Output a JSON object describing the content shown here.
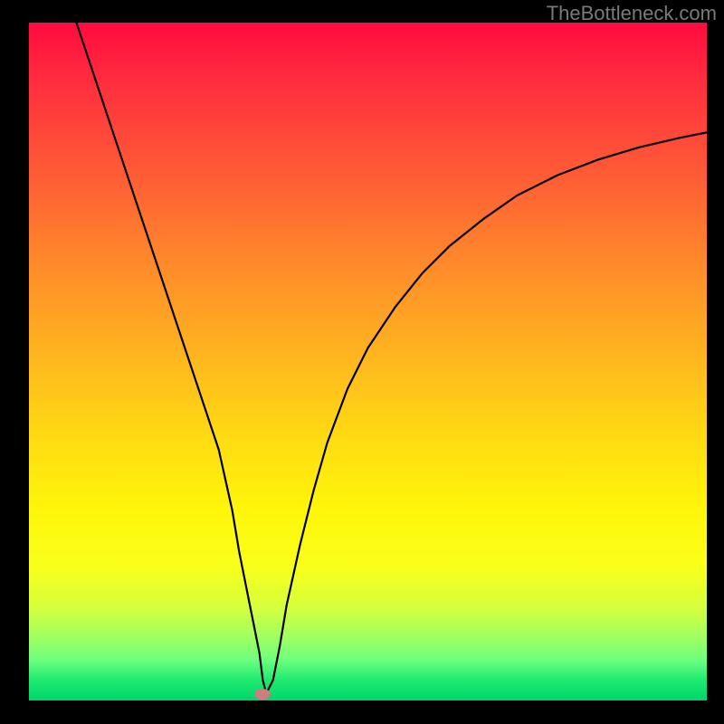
{
  "watermark": "TheBottleneck.com",
  "colors": {
    "frame": "#000000",
    "curve": "#000000",
    "marker": "#cc7d80"
  },
  "chart_data": {
    "type": "line",
    "title": "",
    "xlabel": "",
    "ylabel": "",
    "xlim": [
      0,
      100
    ],
    "ylim": [
      0,
      100
    ],
    "grid": false,
    "legend": false,
    "x": [
      7,
      10,
      13,
      16,
      19,
      22,
      25,
      28,
      30,
      31,
      32,
      33,
      34,
      34.5,
      35,
      36,
      37,
      38,
      40,
      42,
      44,
      47,
      50,
      54,
      58,
      62,
      67,
      72,
      78,
      84,
      90,
      96,
      100
    ],
    "values": [
      100,
      91,
      82,
      73,
      64,
      55,
      46,
      37,
      28,
      22,
      17,
      12,
      7,
      3,
      1,
      3,
      8,
      14,
      23,
      31,
      38,
      46,
      52,
      58,
      63,
      67,
      71,
      74.5,
      77.5,
      79.8,
      81.6,
      83,
      83.8
    ],
    "marker": {
      "x": 34.5,
      "y": 1
    },
    "description": "Asymmetric V-shaped bottleneck curve on a red-to-green vertical gradient background. The curve falls steeply and linearly from upper-left to a minimum near x≈34.5, then rises with a concave, decelerating shape toward the right edge."
  }
}
